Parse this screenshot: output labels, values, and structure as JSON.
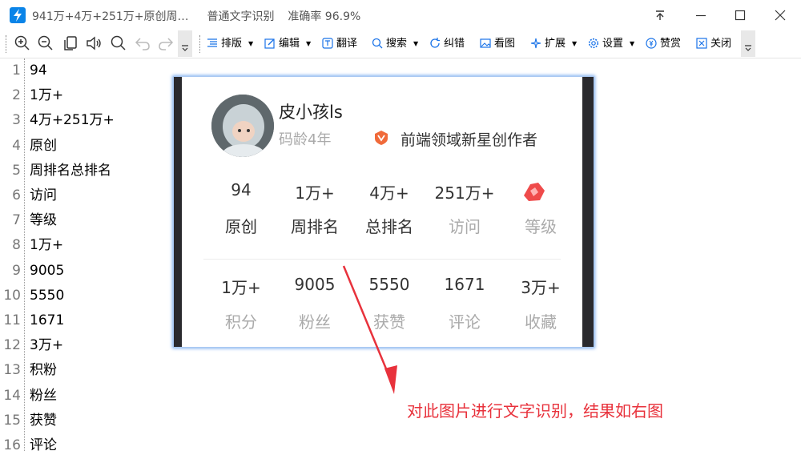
{
  "window": {
    "title": "941万+4万+251万+原创周…",
    "mode": "普通文字识别",
    "accuracy": "准确率 96.9%",
    "accent": "#0a84e8"
  },
  "toolbar": {
    "icons": [
      "zoom-in-icon",
      "zoom-out-icon",
      "copy-icon",
      "speaker-icon",
      "search-icon",
      "undo-icon",
      "redo-icon"
    ],
    "layout_label": "排版",
    "edit_label": "编辑",
    "translate_label": "翻译",
    "search_label": "搜索",
    "correct_label": "纠错",
    "view_image_label": "看图",
    "extend_label": "扩展",
    "settings_label": "设置",
    "donate_label": "赞赏",
    "close_label": "关闭"
  },
  "editor": {
    "lines": [
      {
        "no": "1",
        "text": "94"
      },
      {
        "no": "2",
        "text": "1万+"
      },
      {
        "no": "3",
        "text": "4万+251万+"
      },
      {
        "no": "4",
        "text": "原创"
      },
      {
        "no": "5",
        "text": "周排名总排名"
      },
      {
        "no": "6",
        "text": "访问"
      },
      {
        "no": "7",
        "text": "等级"
      },
      {
        "no": "8",
        "text": "1万+"
      },
      {
        "no": "9",
        "text": "9005"
      },
      {
        "no": "10",
        "text": "5550"
      },
      {
        "no": "11",
        "text": "1671"
      },
      {
        "no": "12",
        "text": "3万+"
      },
      {
        "no": "13",
        "text": "积粉"
      },
      {
        "no": "14",
        "text": "粉丝"
      },
      {
        "no": "15",
        "text": "获赞"
      },
      {
        "no": "16",
        "text": "评论"
      }
    ]
  },
  "profile": {
    "nickname": "皮小孩ls",
    "code_age": "码龄4年",
    "badge_text": "前端领域新星创作者",
    "stats_row1": [
      {
        "value": "94",
        "label": "原创"
      },
      {
        "value": "1万+",
        "label": "周排名"
      },
      {
        "value": "4万+",
        "label": "总排名"
      },
      {
        "value": "251万+",
        "label": "访问"
      },
      {
        "value": "",
        "label": "等级"
      }
    ],
    "stats_row2": [
      {
        "value": "1万+",
        "label": "积分"
      },
      {
        "value": "9005",
        "label": "粉丝"
      },
      {
        "value": "5550",
        "label": "获赞"
      },
      {
        "value": "1671",
        "label": "评论"
      },
      {
        "value": "3万+",
        "label": "收藏"
      }
    ]
  },
  "annotation": {
    "text": "对此图片进行文字识别，结果如右图",
    "color": "#e8323c"
  }
}
